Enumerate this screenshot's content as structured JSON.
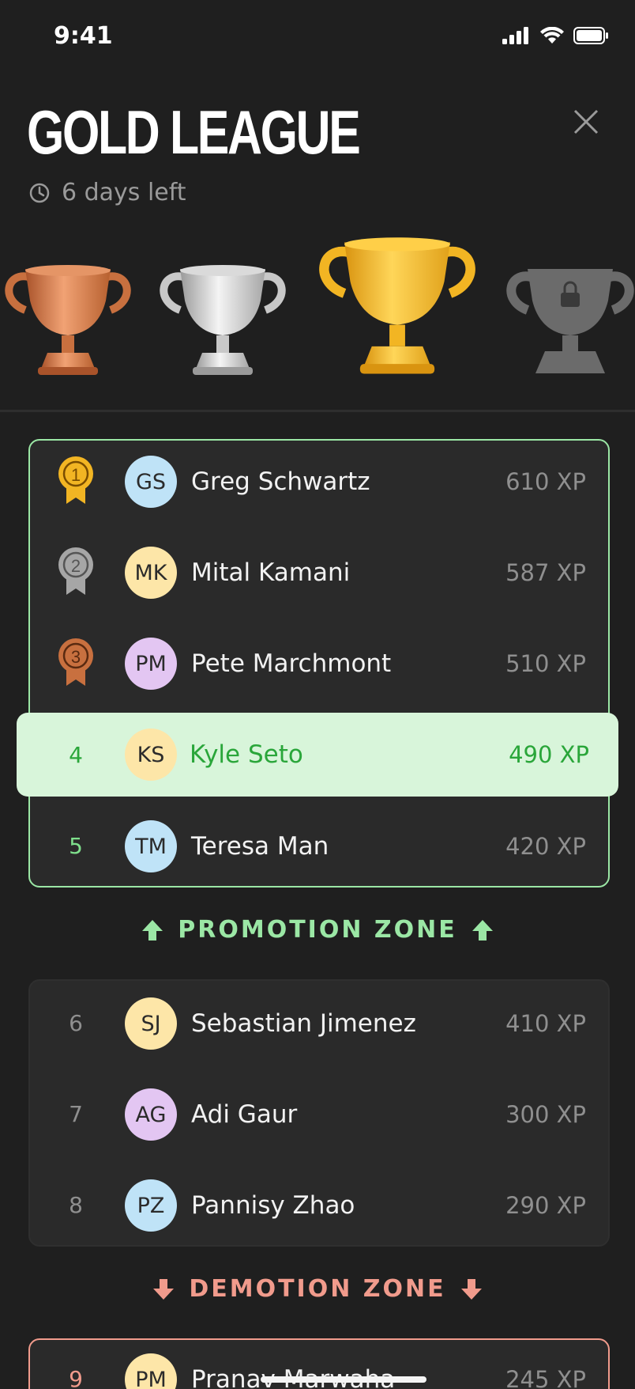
{
  "status_bar": {
    "time": "9:41"
  },
  "header": {
    "title": "GOLD LEAGUE",
    "days_left": "6 days left"
  },
  "trophies": [
    {
      "name": "bronze",
      "color": "#c8703f",
      "locked": false
    },
    {
      "name": "silver",
      "color": "#c8c8c8",
      "locked": false
    },
    {
      "name": "gold",
      "color": "#f2b523",
      "locked": false
    },
    {
      "name": "locked",
      "color": "#6b6b6b",
      "locked": true
    }
  ],
  "leaderboard": {
    "promotion": [
      {
        "rank": "1",
        "medal": "gold",
        "initials": "GS",
        "name": "Greg Schwartz",
        "xp": "610 XP"
      },
      {
        "rank": "2",
        "medal": "silver",
        "initials": "MK",
        "name": "Mital Kamani",
        "xp": "587 XP"
      },
      {
        "rank": "3",
        "medal": "bronze",
        "initials": "PM",
        "name": "Pete Marchmont",
        "xp": "510 XP"
      },
      {
        "rank": "4",
        "initials": "KS",
        "name": "Kyle Seto",
        "xp": "490 XP",
        "current_user": true
      },
      {
        "rank": "5",
        "initials": "TM",
        "name": "Teresa Man",
        "xp": "420 XP"
      }
    ],
    "promotion_label": "PROMOTION ZONE",
    "middle": [
      {
        "rank": "6",
        "initials": "SJ",
        "name": "Sebastian Jimenez",
        "xp": "410 XP"
      },
      {
        "rank": "7",
        "initials": "AG",
        "name": "Adi Gaur",
        "xp": "300 XP"
      },
      {
        "rank": "8",
        "initials": "PZ",
        "name": "Pannisy Zhao",
        "xp": "290 XP"
      }
    ],
    "demotion_label": "DEMOTION ZONE",
    "demotion": [
      {
        "rank": "9",
        "initials": "PM",
        "name": "Pranav Marwaha",
        "xp": "245 XP"
      }
    ]
  },
  "colors": {
    "promotion": "#9be7a5",
    "demotion": "#f19b8c",
    "current_user_bg": "#d8f5da",
    "current_user_text": "#2aa63a"
  }
}
